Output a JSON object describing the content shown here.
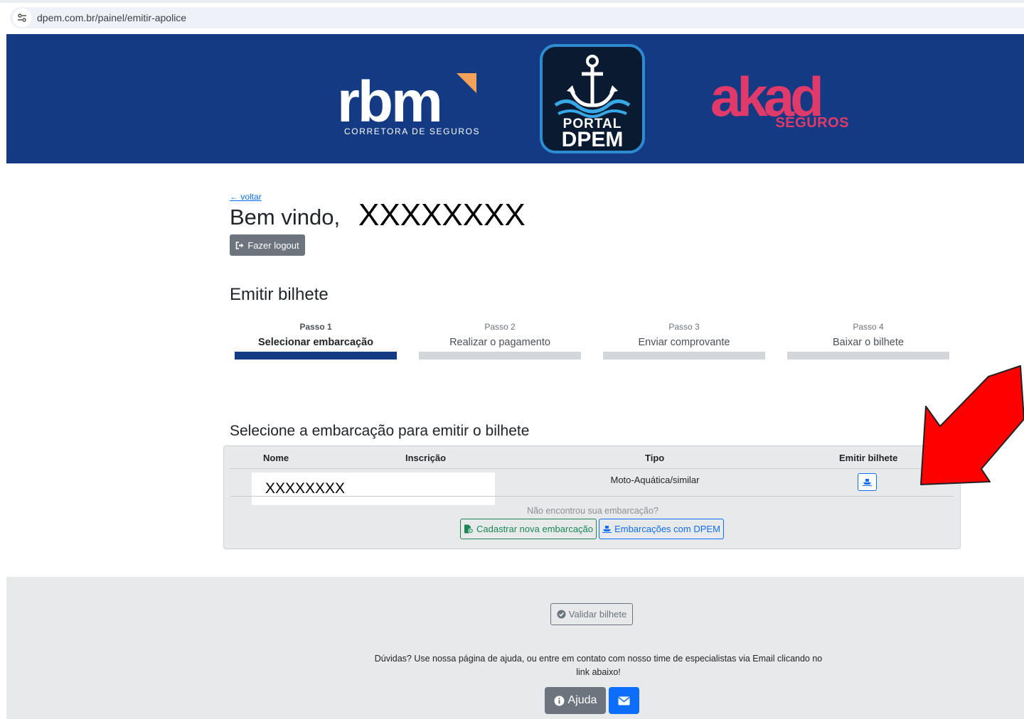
{
  "browser": {
    "url": "dpem.com.br/painel/emitir-apolice",
    "site_icon": "tune-icon"
  },
  "banner": {
    "brand_left": {
      "word": "rbm",
      "subtitle": "CORRETORA DE SEGUROS"
    },
    "brand_center": {
      "line1": "PORTAL",
      "line2": "DPEM",
      "icon": "anchor-icon"
    },
    "brand_right": {
      "word": "akad",
      "subtitle": "SEGUROS"
    },
    "colors": {
      "background": "#143a83",
      "akad": "#e03a6a",
      "rbm_accent": "#f4a259"
    }
  },
  "header": {
    "back_link": "voltar",
    "welcome": "Bem vindo,",
    "user_name": "XXXXXXXX",
    "logout_label": "Fazer logout"
  },
  "section_title": "Emitir bilhete",
  "steps": [
    {
      "number": "Passo 1",
      "label": "Selecionar embarcação",
      "active": true
    },
    {
      "number": "Passo 2",
      "label": "Realizar o pagamento",
      "active": false
    },
    {
      "number": "Passo 3",
      "label": "Enviar comprovante",
      "active": false
    },
    {
      "number": "Passo 4",
      "label": "Baixar o bilhete",
      "active": false
    }
  ],
  "vessel_section": {
    "title": "Selecione a embarcação para emitir o bilhete",
    "columns": [
      "Nome",
      "Inscrição",
      "Tipo",
      "Emitir bilhete"
    ],
    "rows": [
      {
        "nome": "XXXXXXXX",
        "inscricao": "",
        "tipo": "Moto-Aquática/similar",
        "action_icon": "ship-icon"
      }
    ],
    "not_found_text": "Não encontrou sua embarcação?",
    "register_button": "Cadastrar nova embarcação",
    "dpem_button": "Embarcações com DPEM"
  },
  "footer": {
    "validate_button": "Validar bilhete",
    "help_text": "Dúvidas? Use nossa página de ajuda, ou entre em contato com nosso time de especialistas via Email clicando no link abaixo!",
    "help_button": "Ajuda",
    "mail_icon": "envelope-icon"
  },
  "annotation": {
    "arrow_color": "#ff0000"
  }
}
